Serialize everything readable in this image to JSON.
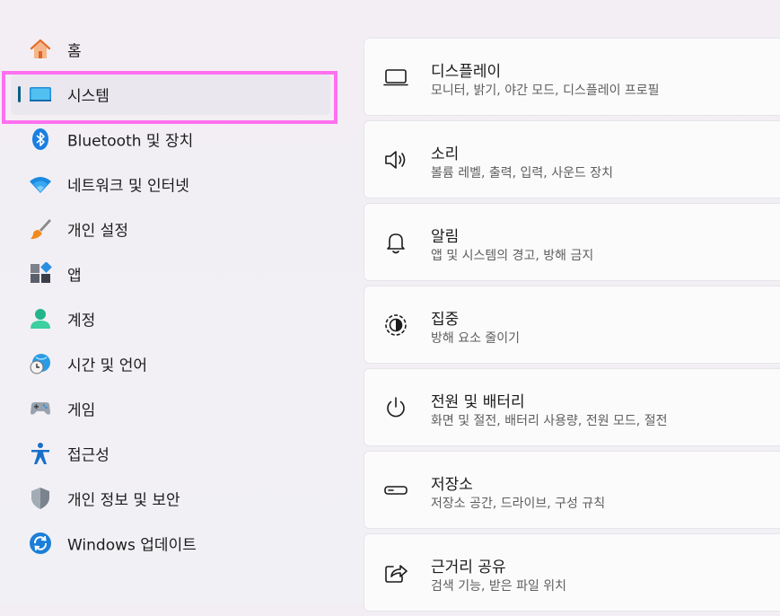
{
  "sidebar": {
    "items": [
      {
        "label": "홈",
        "icon": "home-icon"
      },
      {
        "label": "시스템",
        "icon": "system-icon",
        "active": true
      },
      {
        "label": "Bluetooth 및 장치",
        "icon": "bluetooth-icon"
      },
      {
        "label": "네트워크 및 인터넷",
        "icon": "wifi-icon"
      },
      {
        "label": "개인 설정",
        "icon": "brush-icon"
      },
      {
        "label": "앱",
        "icon": "apps-icon"
      },
      {
        "label": "계정",
        "icon": "account-icon"
      },
      {
        "label": "시간 및 언어",
        "icon": "time-language-icon"
      },
      {
        "label": "게임",
        "icon": "gamepad-icon"
      },
      {
        "label": "접근성",
        "icon": "accessibility-icon"
      },
      {
        "label": "개인 정보 및 보안",
        "icon": "shield-icon"
      },
      {
        "label": "Windows 업데이트",
        "icon": "update-icon"
      }
    ]
  },
  "main": {
    "cards": [
      {
        "title": "디스플레이",
        "desc": "모니터, 밝기, 야간 모드, 디스플레이 프로필",
        "icon": "display-icon"
      },
      {
        "title": "소리",
        "desc": "볼륨 레벨, 출력, 입력, 사운드 장치",
        "icon": "speaker-icon"
      },
      {
        "title": "알림",
        "desc": "앱 및 시스템의 경고, 방해 금지",
        "icon": "bell-icon"
      },
      {
        "title": "집중",
        "desc": "방해 요소 줄이기",
        "icon": "focus-icon"
      },
      {
        "title": "전원 및 배터리",
        "desc": "화면 및 절전, 배터리 사용량, 전원 모드, 절전",
        "icon": "power-icon"
      },
      {
        "title": "저장소",
        "desc": "저장소 공간, 드라이브, 구성 규칙",
        "icon": "storage-icon"
      },
      {
        "title": "근거리 공유",
        "desc": "검색 기능, 받은 파일 위치",
        "icon": "share-icon"
      }
    ]
  },
  "colors": {
    "accent": "#0a5f86",
    "highlight": "#ff71f0"
  }
}
